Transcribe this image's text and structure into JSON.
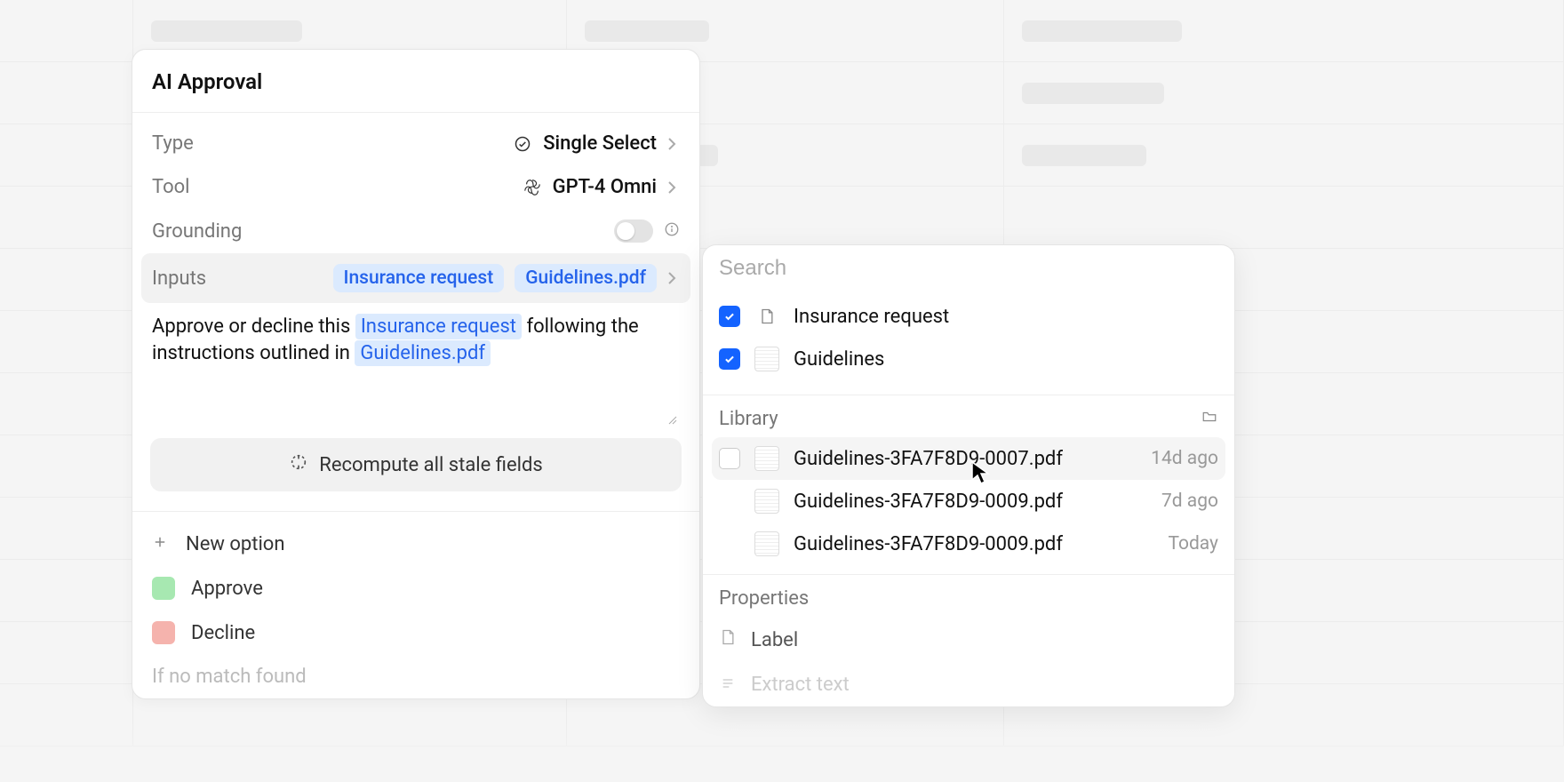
{
  "panel": {
    "title": "AI Approval",
    "rows": {
      "type": {
        "label": "Type",
        "value": "Single Select"
      },
      "tool": {
        "label": "Tool",
        "value": "GPT-4 Omni"
      },
      "grounding": {
        "label": "Grounding"
      },
      "inputs": {
        "label": "Inputs",
        "chips": [
          "Insurance request",
          "Guidelines.pdf"
        ]
      }
    },
    "prompt": {
      "pre": "Approve or decline this ",
      "token1": "Insurance request",
      "mid": " following the instructions outlined in ",
      "token2": "Guidelines.pdf"
    },
    "recompute": "Recompute all stale fields",
    "options": {
      "new": "New option",
      "approve": "Approve",
      "decline": "Decline",
      "nomatch": "If no match found"
    }
  },
  "popover": {
    "search_placeholder": "Search",
    "selected": [
      {
        "name": "Insurance request",
        "icon": "page"
      },
      {
        "name": "Guidelines",
        "icon": "thumb"
      }
    ],
    "library_label": "Library",
    "library": [
      {
        "name": "Guidelines-3FA7F8D9-0007.pdf",
        "time": "14d ago",
        "hovered": true,
        "show_checkbox": true
      },
      {
        "name": "Guidelines-3FA7F8D9-0009.pdf",
        "time": "7d ago",
        "hovered": false,
        "show_checkbox": false
      },
      {
        "name": "Guidelines-3FA7F8D9-0009.pdf",
        "time": "Today",
        "hovered": false,
        "show_checkbox": false
      }
    ],
    "properties_label": "Properties",
    "properties": [
      {
        "name": "Label",
        "icon": "page"
      },
      {
        "name": "Extract text",
        "icon": "lines"
      }
    ]
  }
}
